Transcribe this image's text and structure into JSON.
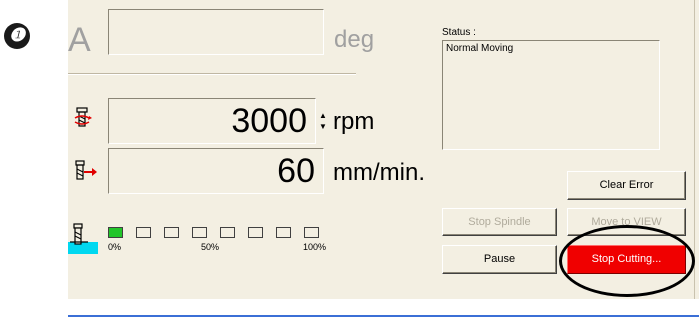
{
  "step_marker": "❶",
  "angle": {
    "axis_label": "A",
    "value": "",
    "unit": "deg"
  },
  "spindle": {
    "value": "3000",
    "unit": "rpm"
  },
  "feed": {
    "value": "60",
    "unit": "mm/min."
  },
  "progress": {
    "filled_segments": 1,
    "total_segments": 8,
    "labels": [
      "0%",
      "50%",
      "100%"
    ]
  },
  "status": {
    "label": "Status :",
    "text": "Normal Moving"
  },
  "buttons": {
    "clear_error": "Clear Error",
    "stop_spindle": "Stop Spindle",
    "move_to": "Move to VIEW",
    "pause": "Pause",
    "stop_cutting": "Stop Cutting..."
  },
  "colors": {
    "panel": "#f3efe2",
    "progress_on": "#22c52a",
    "stop_button": "#f00000",
    "underline": "#3b6fd6"
  }
}
